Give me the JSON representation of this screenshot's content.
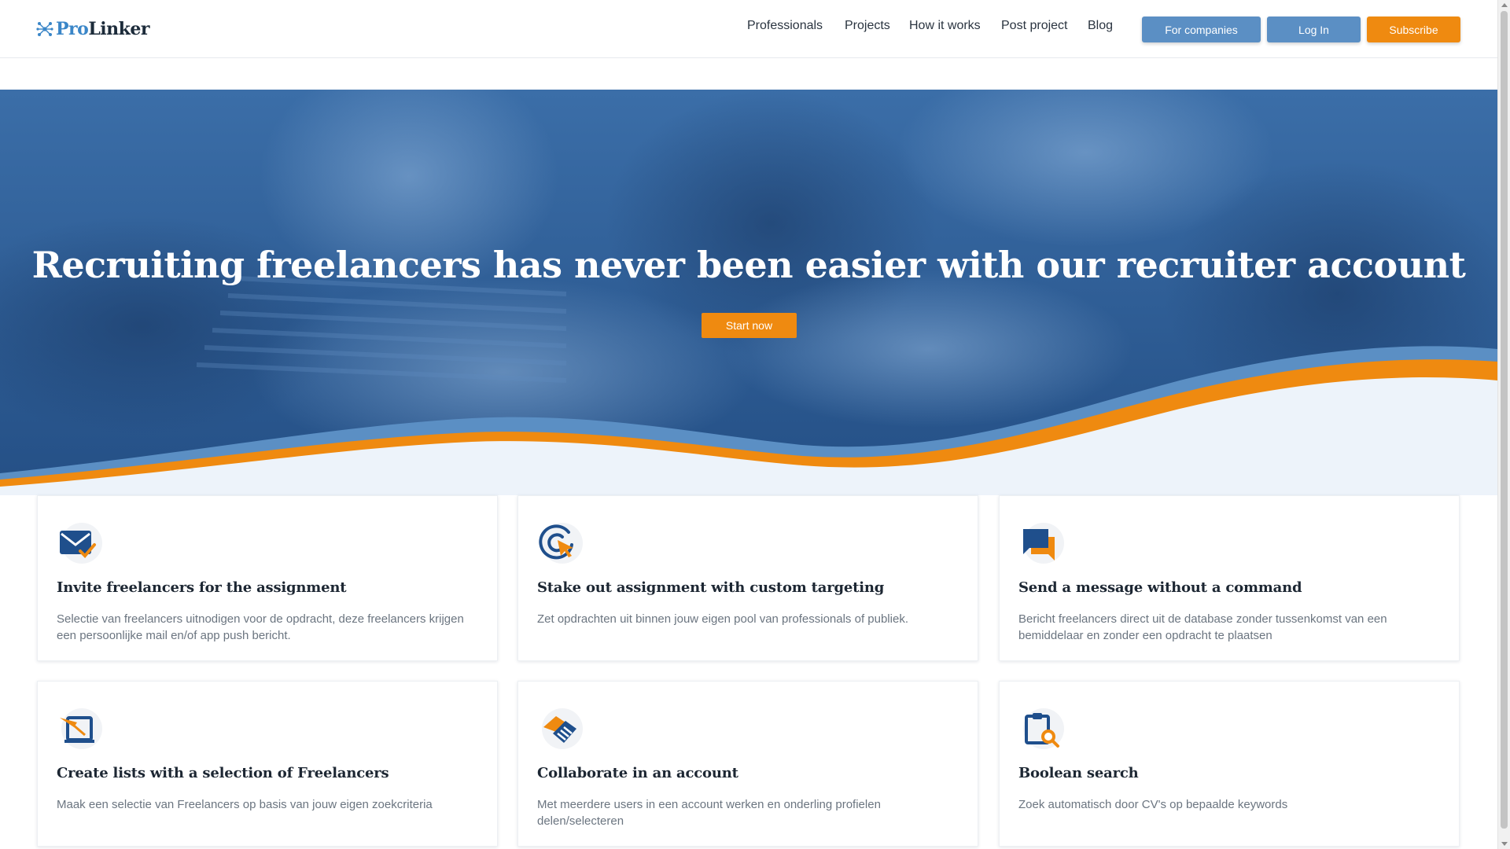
{
  "brand": {
    "logo_part1": "Pro",
    "logo_part2": "Linker",
    "logo_icon": "network-icon"
  },
  "nav": {
    "items": [
      "Professionals",
      "Projects",
      "How it works",
      "Post project",
      "Blog"
    ]
  },
  "header_buttons": {
    "companies": "For companies",
    "login": "Log In",
    "subscribe": "Subscribe"
  },
  "hero": {
    "title": "Recruiting freelancers has never been easier with our recruiter account",
    "cta": "Start now"
  },
  "features": [
    {
      "icon": "envelope-check-icon",
      "title": "Invite freelancers for the assignment",
      "text": "Selectie van freelancers uitnodigen voor de opdracht, deze freelancers krijgen een persoonlijke mail en/of app push bericht."
    },
    {
      "icon": "target-cursor-icon",
      "title": "Stake out assignment with custom targeting",
      "text": "Zet opdrachten uit binnen jouw eigen pool van professionals of publiek."
    },
    {
      "icon": "chat-bubbles-icon",
      "title": "Send a message without a command",
      "text": "Bericht freelancers direct uit de database zonder tussenkomst van een bemiddelaar en zonder een opdracht te plaatsen"
    },
    {
      "icon": "laptop-pen-icon",
      "title": "Create lists with a selection of Freelancers",
      "text": "Maak een selectie van Freelancers op basis van jouw eigen zoekcriteria"
    },
    {
      "icon": "handshake-icon",
      "title": "Collaborate in an account",
      "text": "Met meerdere users in een account werken en onderling profielen delen/selecteren"
    },
    {
      "icon": "clipboard-search-icon",
      "title": "Boolean search",
      "text": "Zoek automatisch door CV's op bepaalde keywords"
    }
  ],
  "colors": {
    "brand_blue": "#3a86c8",
    "accent_orange": "#ef8a10",
    "button_blue": "#5b8fc4",
    "hero_overlay": "#2d5f98"
  }
}
